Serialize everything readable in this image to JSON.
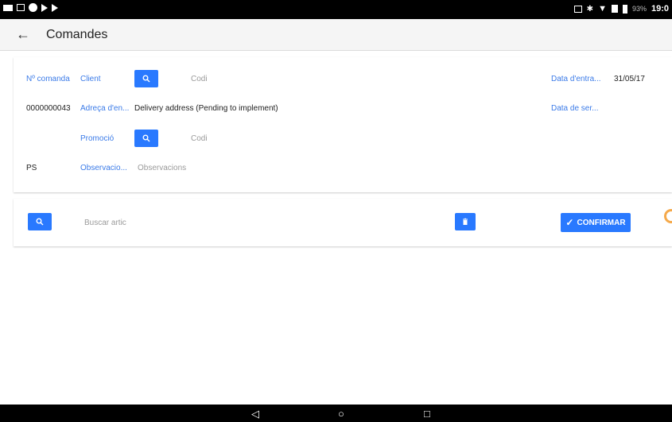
{
  "status_bar": {
    "battery": "93%",
    "time": "19:0"
  },
  "app_bar": {
    "title": "Comandes"
  },
  "order": {
    "number_label": "Nº comanda",
    "number_value": "0000000043",
    "client_label": "Client",
    "client_placeholder": "Codi",
    "address_label": "Adreça d'en...",
    "address_value": "Delivery address (Pending to implement)",
    "promo_label": "Promoció",
    "promo_placeholder": "Codi",
    "ps_value": "PS",
    "obs_label": "Observacio...",
    "obs_placeholder": "Observacions",
    "entry_date_label": "Data d'entra...",
    "entry_date_value": "31/05/17",
    "service_date_label": "Data de ser..."
  },
  "articles": {
    "search_placeholder": "Buscar artic",
    "confirm_label": "CONFIRMAR"
  },
  "colors": {
    "accent": "#2979ff",
    "label_blue": "#3b7be8"
  }
}
